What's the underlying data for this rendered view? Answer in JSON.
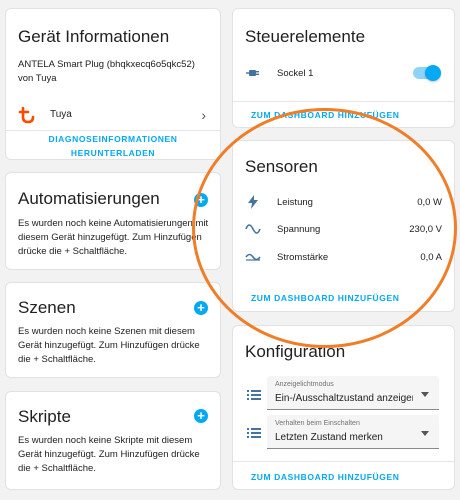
{
  "device_info": {
    "title": "Gerät Informationen",
    "model": "ANTELA Smart Plug (bhqkxecq6o5qkc52)",
    "by": "von Tuya",
    "integration": "Tuya",
    "diagnostics_line1": "DIAGNOSEINFORMATIONEN",
    "diagnostics_line2": "HERUNTERLADEN"
  },
  "automations": {
    "title": "Automatisierungen",
    "desc": "Es wurden noch keine Automatisierungen mit diesem Gerät hinzugefügt. Zum Hinzufügen drücke die + Schaltfläche."
  },
  "scenes": {
    "title": "Szenen",
    "desc": "Es wurden noch keine Szenen mit diesem Gerät hinzugefügt. Zum Hinzufügen drücke die + Schaltfläche."
  },
  "scripts": {
    "title": "Skripte",
    "desc": "Es wurden noch keine Skripte mit diesem Gerät hinzugefügt. Zum Hinzufügen drücke die + Schaltfläche."
  },
  "controls": {
    "title": "Steuerelemente",
    "switch_label": "Sockel 1",
    "switch_on": true,
    "add_link": "ZUM DASHBOARD HINZUFÜGEN"
  },
  "sensors": {
    "title": "Sensoren",
    "rows": [
      {
        "label": "Leistung",
        "value": "0,0 W"
      },
      {
        "label": "Spannung",
        "value": "230,0 V"
      },
      {
        "label": "Stromstärke",
        "value": "0,0 A"
      }
    ],
    "add_link": "ZUM DASHBOARD HINZUFÜGEN"
  },
  "configuration": {
    "title": "Konfiguration",
    "select1_label": "Anzeigelichtmodus",
    "select1_value": "Ein-/Ausschaltzustand anzeigen",
    "select2_label": "Verhalten beim Einschalten",
    "select2_value": "Letzten Zustand merken",
    "add_link": "ZUM DASHBOARD HINZUFÜGEN"
  },
  "colors": {
    "accent": "#03a9f4",
    "tuya": "#ff4800",
    "highlight": "#f07d28"
  }
}
